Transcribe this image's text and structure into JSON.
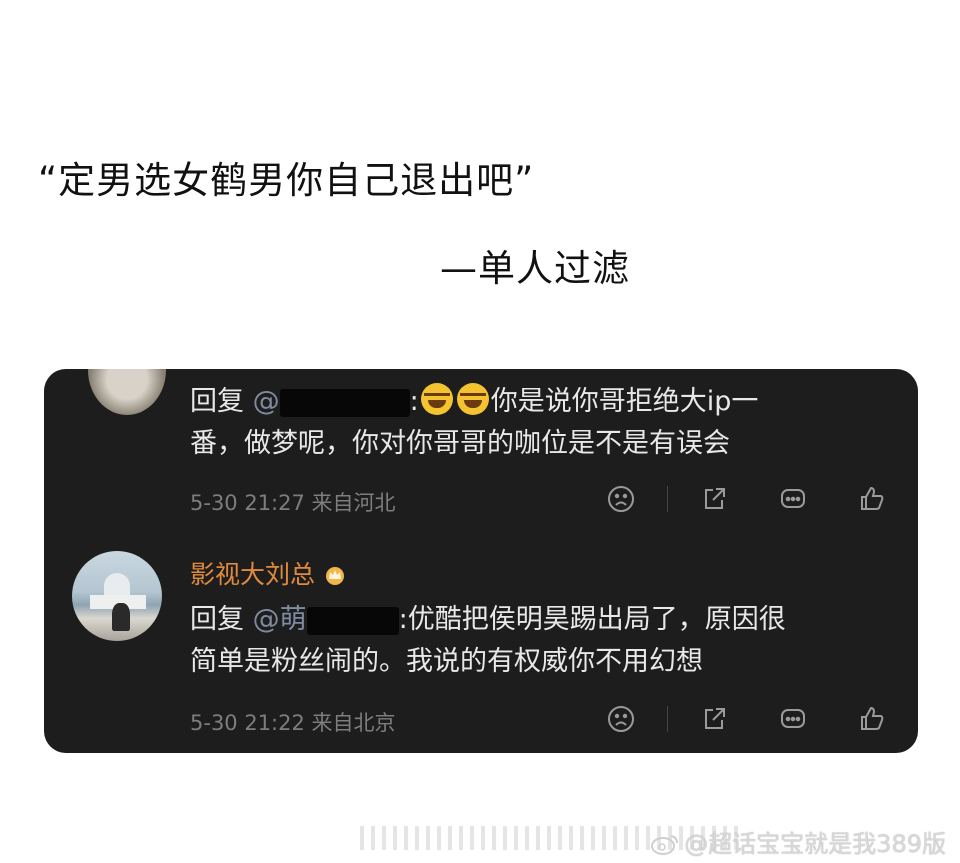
{
  "header": {
    "quote": "“定男选女鹤男你自己退出吧”",
    "attribution": "—单人过滤"
  },
  "comments": [
    {
      "reply_prefix": "回复",
      "mention": "@",
      "mention_tail": ":",
      "line1_text": "你是说你哥拒绝大ip一",
      "line2_text": "番，做梦呢，你对你哥哥的咖位是不是有误会",
      "timestamp": "5-30 21:27",
      "location": "来自河北"
    },
    {
      "username": "影视大刘总",
      "reply_prefix": "回复",
      "mention": "@萌",
      "mention_tail": ":",
      "line1_text": "优酷把侯明昊踢出局了，原因很",
      "line2_text": "简单是粉丝闹的。我说的有权威你不用幻想",
      "timestamp": "5-30 21:22",
      "location": "来自北京"
    }
  ],
  "actions": [
    "frown-icon",
    "share-icon",
    "comment-icon",
    "like-icon"
  ],
  "watermark": {
    "text": "@超话宝宝就是我389版"
  },
  "colors": {
    "card_bg": "#1d1d1d",
    "username": "#e08a3c",
    "mention": "#7f8ba0",
    "meta": "#7d7d7d"
  }
}
